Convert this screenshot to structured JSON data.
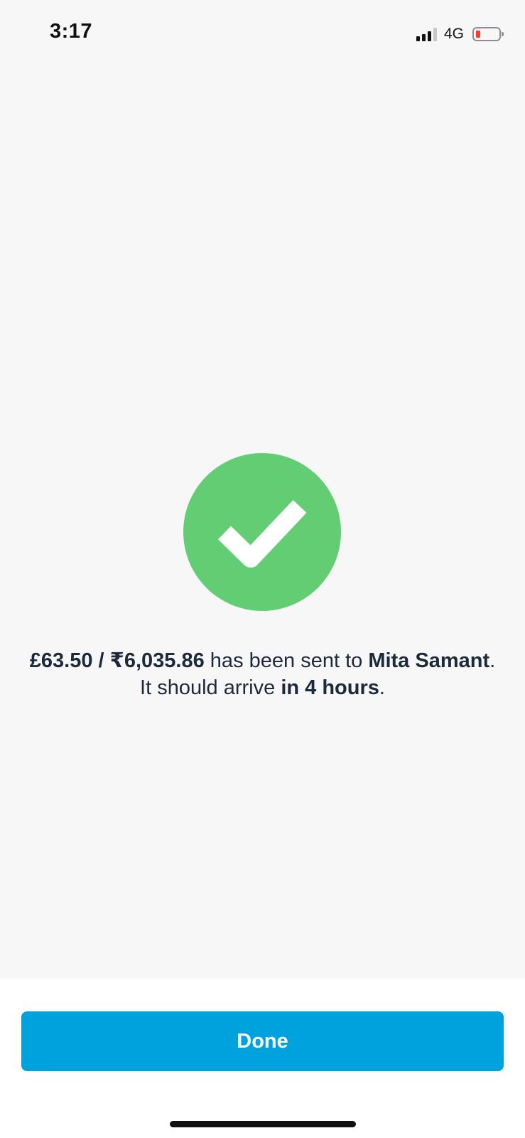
{
  "status_bar": {
    "time": "3:17",
    "network": "4G",
    "battery_color": "#ff3b30"
  },
  "success": {
    "icon": "checkmark-icon",
    "circle_color": "#63cd74",
    "amount_gbp": "£63.50",
    "separator": " / ",
    "amount_inr": "₹6,035.86",
    "sent_text": " has been sent to ",
    "recipient": "Mita Samant",
    "arrive_text": ". It should arrive ",
    "eta": "in 4 hours",
    "end_text": "."
  },
  "actions": {
    "done_label": "Done",
    "button_color": "#00a2dd"
  }
}
